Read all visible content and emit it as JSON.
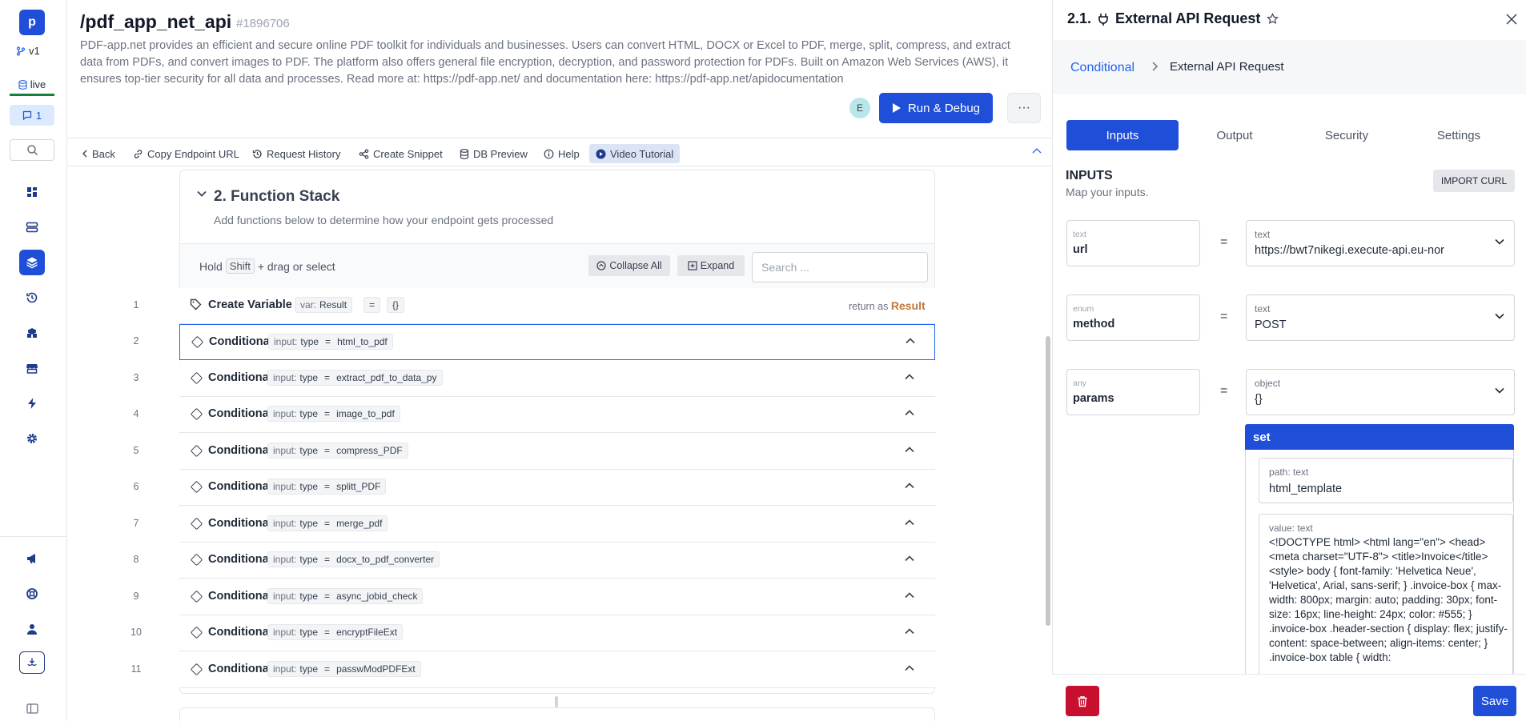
{
  "rail": {
    "logo": "p",
    "branch": "v1",
    "env": "live",
    "comments": "1",
    "accent": "#1f4ed8",
    "icons": [
      "dashboard-icon",
      "database-icon",
      "layers-icon",
      "history-icon",
      "addon-icon",
      "store-icon",
      "bolt-icon",
      "gear-icon",
      "megaphone-icon",
      "lifebuoy-icon",
      "user-icon",
      "deploy-icon",
      "sidebar-toggle-icon"
    ]
  },
  "header": {
    "title": "/pdf_app_net_api",
    "id": "#1896706",
    "description": "PDF-app.net provides an efficient and secure online PDF toolkit for individuals and businesses. Users can convert HTML, DOCX or Excel to PDF, merge, split, compress, and extract data from PDFs, and convert images to PDF. The platform also offers general file encryption, decryption, and password protection for PDFs. Built on Amazon Web Services (AWS), it ensures top-tier security for all data and processes. Read more at: https://pdf-app.net/ and documentation here: https://pdf-app.net/apidocumentation",
    "avatar": "E",
    "run_label": "Run & Debug",
    "more_label": "···"
  },
  "toolbar": {
    "back": "Back",
    "copy_url": "Copy Endpoint URL",
    "history": "Request History",
    "snippet": "Create Snippet",
    "db_preview": "DB Preview",
    "help": "Help",
    "video": "Video Tutorial"
  },
  "stack": {
    "title": "2. Function Stack",
    "subtitle": "Add functions below to determine how your endpoint gets processed",
    "hold": "Hold",
    "shift": "Shift",
    "hold_suffix": "+ drag or select",
    "collapse_all": "Collapse All",
    "expand": "Expand",
    "search_placeholder": "Search ...",
    "first": {
      "num": "1",
      "label": "Create Variable",
      "var_key": "var:",
      "var_val": "Result",
      "eq": "=",
      "obj": "{}",
      "return_as": "return as",
      "return_val": "Result"
    },
    "rows": [
      {
        "num": "2",
        "label": "Conditional: If",
        "k": "input:",
        "f": "type",
        "op": "=",
        "v": "html_to_pdf"
      },
      {
        "num": "3",
        "label": "Conditional: If",
        "k": "input:",
        "f": "type",
        "op": "=",
        "v": "extract_pdf_to_data_py"
      },
      {
        "num": "4",
        "label": "Conditional: If",
        "k": "input:",
        "f": "type",
        "op": "=",
        "v": "image_to_pdf"
      },
      {
        "num": "5",
        "label": "Conditional: If",
        "k": "input:",
        "f": "type",
        "op": "=",
        "v": "compress_PDF"
      },
      {
        "num": "6",
        "label": "Conditional: If",
        "k": "input:",
        "f": "type",
        "op": "=",
        "v": "splitt_PDF"
      },
      {
        "num": "7",
        "label": "Conditional: If",
        "k": "input:",
        "f": "type",
        "op": "=",
        "v": "merge_pdf"
      },
      {
        "num": "8",
        "label": "Conditional: If",
        "k": "input:",
        "f": "type",
        "op": "=",
        "v": "docx_to_pdf_converter"
      },
      {
        "num": "9",
        "label": "Conditional: If",
        "k": "input:",
        "f": "type",
        "op": "=",
        "v": "async_jobid_check"
      },
      {
        "num": "10",
        "label": "Conditional: If",
        "k": "input:",
        "f": "type",
        "op": "=",
        "v": "encryptFileExt"
      },
      {
        "num": "11",
        "label": "Conditional: If",
        "k": "input:",
        "f": "type",
        "op": "=",
        "v": "passwModPDFExt"
      }
    ]
  },
  "panel": {
    "title": "2.1.",
    "title_name": "External API Request",
    "crumb_parent": "Conditional",
    "crumb_current": "External API Request",
    "tabs": [
      "Inputs",
      "Output",
      "Security",
      "Settings"
    ],
    "inputs_heading": "INPUTS",
    "inputs_sub": "Map your inputs.",
    "import_curl": "IMPORT CURL",
    "inputs": [
      {
        "type": "text",
        "name": "url",
        "value_type": "text",
        "value": "https://bwt7nikegi.execute-api.eu-nor"
      },
      {
        "type": "enum",
        "name": "method",
        "value_type": "text",
        "value": "POST"
      },
      {
        "type": "any",
        "name": "params",
        "value_type": "object",
        "value": "{}"
      }
    ],
    "set_label": "set",
    "path_label": "path: text",
    "path_value": "html_template",
    "value_label": "value: text",
    "value_code": "<!DOCTYPE html> <html lang=\"en\"> <head> <meta charset=\"UTF-8\"> <title>Invoice</title> <style> body { font-family: 'Helvetica Neue', 'Helvetica', Arial, sans-serif; } .invoice-box { max-width: 800px; margin: auto; padding: 30px; font-size: 16px; line-height: 24px; color: #555; } .invoice-box .header-section { display: flex; justify-content: space-between; align-items: center; } .invoice-box table { width:",
    "save_label": "Save"
  }
}
